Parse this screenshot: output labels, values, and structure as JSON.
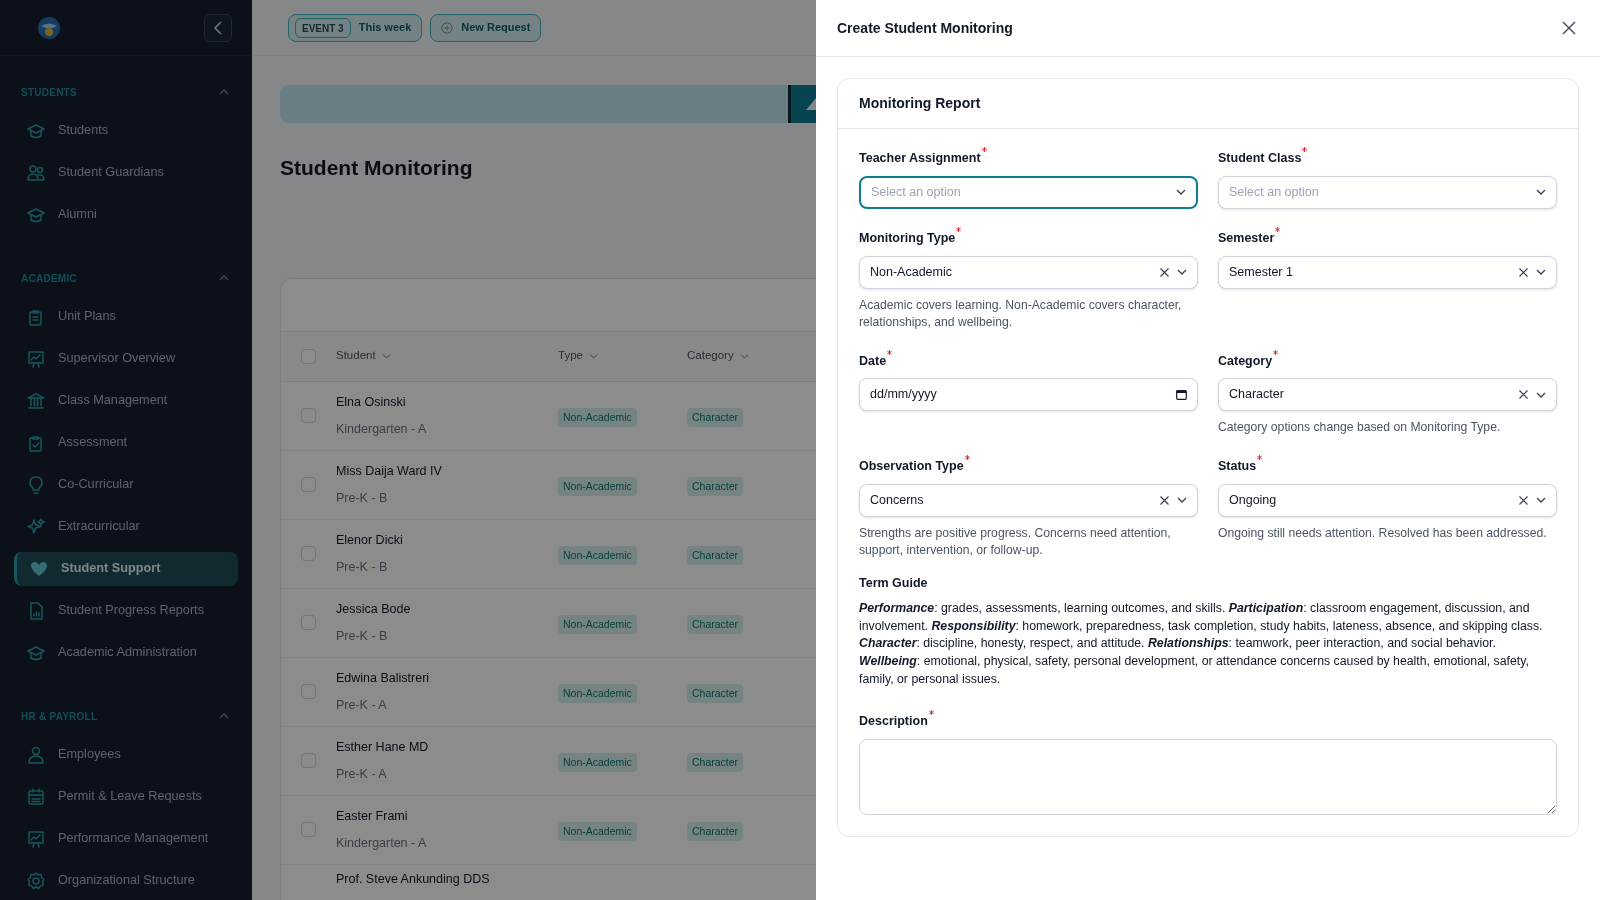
{
  "sidebar": {
    "sections": [
      {
        "title": "STUDENTS",
        "expanded": true,
        "items": [
          {
            "label": "Students",
            "selected": false
          },
          {
            "label": "Student Guardians",
            "selected": false
          },
          {
            "label": "Alumni",
            "selected": false
          }
        ]
      },
      {
        "title": "ACADEMIC",
        "expanded": true,
        "items": [
          {
            "label": "Unit Plans",
            "selected": false
          },
          {
            "label": "Supervisor Overview",
            "selected": false
          },
          {
            "label": "Class Management",
            "selected": false
          },
          {
            "label": "Assessment",
            "selected": false
          },
          {
            "label": "Co-Curricular",
            "selected": false
          },
          {
            "label": "Extracurricular",
            "selected": false
          },
          {
            "label": "Student Support",
            "selected": true
          },
          {
            "label": "Student Progress Reports",
            "selected": false
          },
          {
            "label": "Academic Administration",
            "selected": false
          }
        ]
      },
      {
        "title": "HR & PAYROLL",
        "expanded": true,
        "items": [
          {
            "label": "Employees",
            "selected": false
          },
          {
            "label": "Permit & Leave Requests",
            "selected": false
          },
          {
            "label": "Performance Management",
            "selected": false
          },
          {
            "label": "Organizational Structure",
            "selected": false
          }
        ]
      }
    ]
  },
  "topbar": {
    "event_badge": "EVENT 3",
    "event_label": "This week",
    "new_request": "New Request"
  },
  "page_title": "Student Monitoring",
  "table": {
    "columns": [
      "Student",
      "Type",
      "Category"
    ],
    "rows": [
      {
        "name": "Elna Osinski",
        "class": "Kindergarten - A",
        "type": "Non-Academic",
        "category": "Character",
        "checked": false
      },
      {
        "name": "Miss Daija Ward IV",
        "class": "Pre-K - B",
        "type": "Non-Academic",
        "category": "Character",
        "checked": false
      },
      {
        "name": "Elenor Dicki",
        "class": "Pre-K - B",
        "type": "Non-Academic",
        "category": "Character",
        "checked": false
      },
      {
        "name": "Jessica Bode",
        "class": "Pre-K - B",
        "type": "Non-Academic",
        "category": "Character",
        "checked": false
      },
      {
        "name": "Edwina Balistreri",
        "class": "Pre-K - A",
        "type": "Non-Academic",
        "category": "Character",
        "checked": false
      },
      {
        "name": "Esther Hane MD",
        "class": "Pre-K - A",
        "type": "Non-Academic",
        "category": "Character",
        "checked": false
      },
      {
        "name": "Easter Frami",
        "class": "Kindergarten - A",
        "type": "Non-Academic",
        "category": "Character",
        "checked": false
      },
      {
        "name": "Prof. Steve Ankunding DDS"
      }
    ],
    "select_all_checked": false
  },
  "modal": {
    "title": "Create Student Monitoring",
    "card_title": "Monitoring Report",
    "fields": [
      {
        "kind": "select",
        "label": "Teacher Assignment",
        "required": true,
        "placeholder": "Select an option",
        "focused": true,
        "clearable": false
      },
      {
        "kind": "select",
        "label": "Student Class",
        "required": true,
        "placeholder": "Select an option",
        "focused": false,
        "clearable": false
      },
      {
        "kind": "select",
        "label": "Monitoring Type",
        "required": true,
        "value": "Non-Academic",
        "focused": false,
        "clearable": true,
        "help": "Academic covers learning. Non-Academic covers character, relationships, and wellbeing."
      },
      {
        "kind": "select",
        "label": "Semester",
        "required": true,
        "value": "Semester 1",
        "focused": false,
        "clearable": true
      },
      {
        "kind": "date",
        "label": "Date",
        "required": true,
        "placeholder": "dd/mm/yyyy",
        "focused": false
      },
      {
        "kind": "select",
        "label": "Category",
        "required": true,
        "value": "Character",
        "focused": false,
        "clearable": true,
        "help": "Category options change based on Monitoring Type."
      },
      {
        "kind": "select",
        "label": "Observation Type",
        "required": true,
        "value": "Concerns",
        "focused": false,
        "clearable": true,
        "help": "Strengths are positive progress. Concerns need attention, support, intervention, or follow-up."
      },
      {
        "kind": "select",
        "label": "Status",
        "required": true,
        "value": "Ongoing",
        "focused": false,
        "clearable": true,
        "help": "Ongoing still needs attention. Resolved has been addressed."
      }
    ],
    "term_guide": {
      "title": "Term Guide",
      "text": "**Performance**: grades, assessments, learning outcomes, and skills. **Participation**: classroom engagement, discussion, and involvement. **Responsibility**: homework, preparedness, task completion, study habits, lateness, absence, and skipping class. **Character**: discipline, honesty, respect, and attitude. **Relationships**: teamwork, peer interaction, and social behavior. **Wellbeing**: emotional, physical, safety, personal development, or attendance concerns caused by health, emotional, safety, family, or personal issues."
    },
    "description": {
      "label": "Description",
      "required": true
    }
  }
}
